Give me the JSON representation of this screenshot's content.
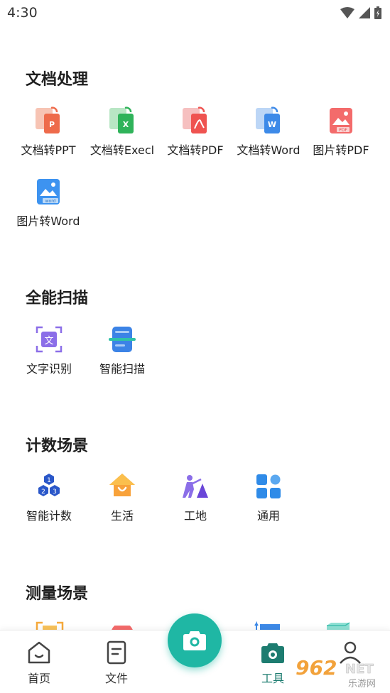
{
  "status": {
    "time": "4:30"
  },
  "sections": [
    {
      "title": "文档处理",
      "items": [
        {
          "label": "文档转PPT",
          "icon": "doc-to-ppt-icon"
        },
        {
          "label": "文档转Execl",
          "icon": "doc-to-excel-icon"
        },
        {
          "label": "文档转PDF",
          "icon": "doc-to-pdf-icon"
        },
        {
          "label": "文档转Word",
          "icon": "doc-to-word-icon"
        },
        {
          "label": "图片转PDF",
          "icon": "image-to-pdf-icon"
        },
        {
          "label": "图片转Word",
          "icon": "image-to-word-icon"
        }
      ]
    },
    {
      "title": "全能扫描",
      "items": [
        {
          "label": "文字识别",
          "icon": "text-recognition-icon"
        },
        {
          "label": "智能扫描",
          "icon": "smart-scan-icon"
        }
      ]
    },
    {
      "title": "计数场景",
      "items": [
        {
          "label": "智能计数",
          "icon": "smart-count-icon"
        },
        {
          "label": "生活",
          "icon": "life-icon"
        },
        {
          "label": "工地",
          "icon": "construction-icon"
        },
        {
          "label": "通用",
          "icon": "general-icon"
        }
      ]
    },
    {
      "title": "测量场景",
      "items": []
    }
  ],
  "nav": {
    "home": "首页",
    "files": "文件",
    "tools": "工具",
    "profile": ""
  },
  "watermark": {
    "brand": "962",
    "suffix": "NET",
    "sub": "乐游网"
  },
  "colors": {
    "accent": "#1fb7a4",
    "active_nav": "#1d7c70"
  }
}
